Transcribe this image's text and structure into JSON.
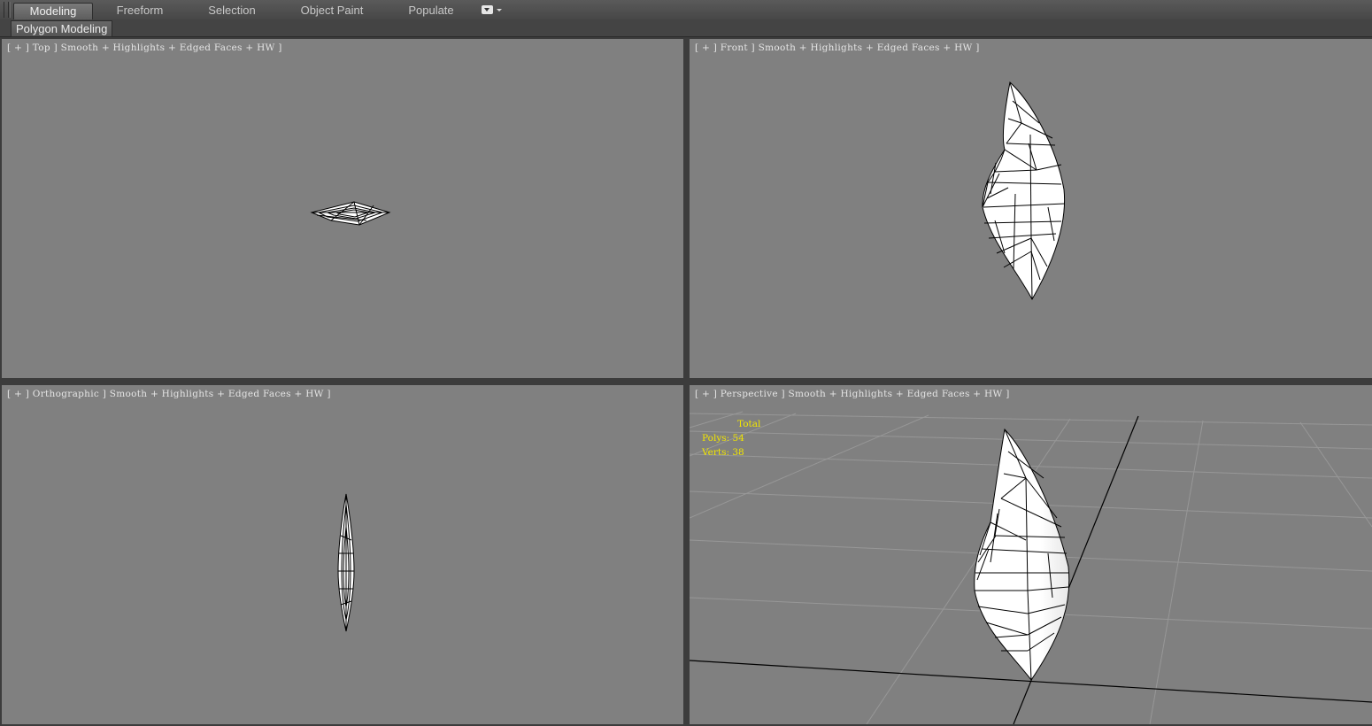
{
  "ribbon": {
    "tabs": [
      {
        "label": "Modeling",
        "active": true
      },
      {
        "label": "Freeform",
        "active": false
      },
      {
        "label": "Selection",
        "active": false
      },
      {
        "label": "Object Paint",
        "active": false
      },
      {
        "label": "Populate",
        "active": false
      }
    ],
    "dropdown_icon": "dropdown-arrow-icon"
  },
  "subpanel": {
    "active_tab": "Polygon Modeling"
  },
  "viewports": {
    "top": {
      "label": "[ + ] Top ] Smooth + Highlights + Edged Faces + HW ]"
    },
    "front": {
      "label": "[ + ] Front ] Smooth + Highlights + Edged Faces + HW ]"
    },
    "ortho": {
      "label": "[ + ] Orthographic ] Smooth + Highlights + Edged Faces + HW ]"
    },
    "perspective": {
      "label": "[ + ] Perspective ] Smooth + Highlights + Edged Faces + HW ]"
    }
  },
  "stats": {
    "total_label": "Total",
    "polys_label": "Polys:",
    "polys_value": "54",
    "verts_label": "Verts:",
    "verts_value": "38"
  },
  "colors": {
    "viewport_bg": "#808080",
    "stats_text": "#f2e600",
    "mesh_fill": "#ffffff",
    "mesh_edges": "#000000"
  }
}
